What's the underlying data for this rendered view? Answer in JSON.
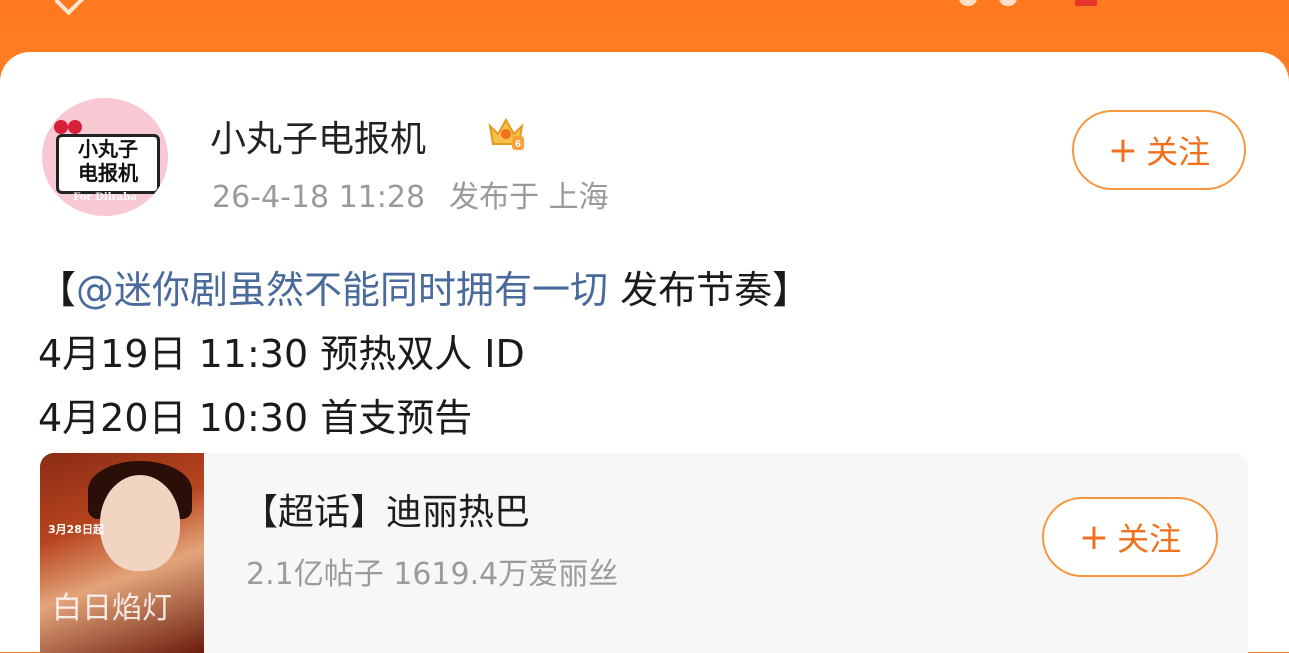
{
  "status_bar": {
    "icons": [
      "back-icon",
      "more-icon",
      "red-notice-icon"
    ]
  },
  "post": {
    "author": {
      "name": "小丸子电报机",
      "avatar_text_line1": "小丸子",
      "avatar_text_line2": "电报机",
      "avatar_subtext": "For Dilraba",
      "badge_icon": "crown-vip-icon",
      "timestamp": "26-4-18 11:28",
      "location": "发布于 上海"
    },
    "follow_label": "关注",
    "content": {
      "open_bracket": "【",
      "mention": "@迷你剧虽然不能同时拥有一切",
      "title_tail": " 发布节奏】",
      "line2": "4月19日 11:30  预热双人 ID",
      "line3": "4月20日 10:30  首支预告"
    }
  },
  "topic_card": {
    "poster_date": "3月28日起",
    "poster_title": "白日焰灯",
    "title": "【超话】迪丽热巴",
    "stats": "2.1亿帖子 1619.4万爱丽丝",
    "follow_label": "关注"
  },
  "colors": {
    "header": "#ff7a1e",
    "accent": "#f0701c",
    "mention": "#4a6a9c",
    "muted": "#9a9a9a"
  }
}
